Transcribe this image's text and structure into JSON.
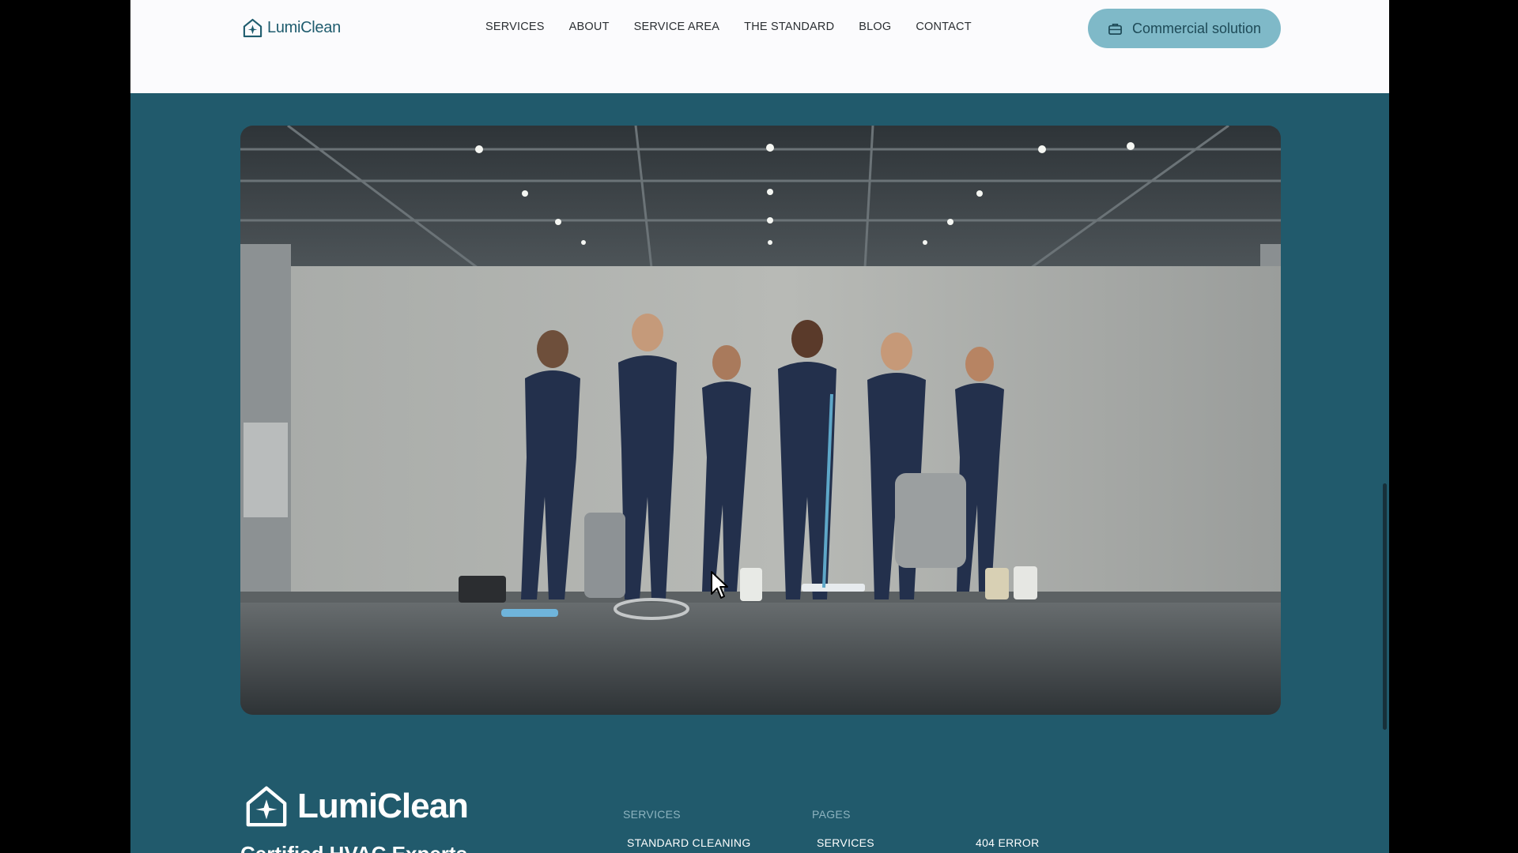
{
  "header": {
    "brand": "LumiClean",
    "nav": [
      "SERVICES",
      "ABOUT",
      "SERVICE AREA",
      "THE STANDARD",
      "BLOG",
      "CONTACT"
    ],
    "cta_label": "Commercial solution",
    "cta_icon": "briefcase-icon"
  },
  "hero": {
    "image_subject": "team of cleaning staff in navy uniforms with cleaning equipment in a warehouse"
  },
  "footer": {
    "brand": "LumiClean",
    "tagline": "Certified HVAC Experts",
    "columns": {
      "services_heading": "SERVICES",
      "services_items": [
        "STANDARD CLEANING"
      ],
      "pages_heading": "PAGES",
      "pages_items": [
        "SERVICES",
        "404 ERROR"
      ]
    }
  },
  "colors": {
    "brand_teal": "#215a6c",
    "cta_bg": "#7fb9c8",
    "header_bg": "#fbfbfd"
  }
}
